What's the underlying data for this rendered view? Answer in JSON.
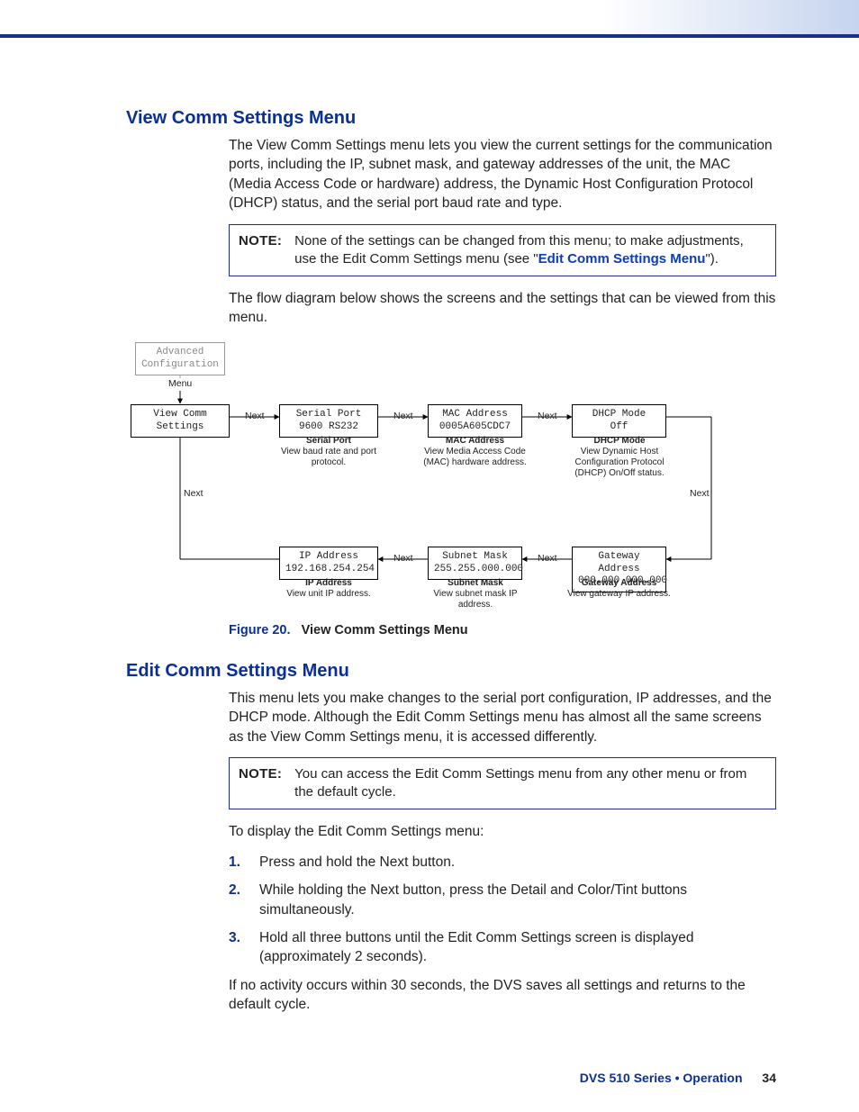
{
  "sections": {
    "view": {
      "heading": "View Comm Settings Menu",
      "intro": "The View Comm Settings menu lets you view the current settings for the communication ports, including the IP, subnet mask, and gateway addresses of the unit, the MAC (Media Access Code or hardware) address, the Dynamic Host Configuration Protocol (DHCP) status, and the serial port baud rate and type.",
      "note_label": "NOTE:",
      "note_text_1": "None of the settings can be changed from this menu; to make adjustments, use the Edit Comm Settings menu (see \"",
      "note_link": "Edit Comm Settings Menu",
      "note_text_2": "\").",
      "flow_intro": "The flow diagram below shows the screens and the settings that can be viewed from this menu."
    },
    "figure": {
      "caption_no": "Figure 20.",
      "caption_title": "View Comm Settings Menu",
      "boxes": {
        "adv_cfg": "Advanced\nConfiguration",
        "menu_label": "Menu",
        "view_comm": "View Comm\nSettings",
        "serial_port": "Serial Port\n9600     RS232",
        "mac": "MAC Address\n0005A605CDC7",
        "dhcp": "DHCP Mode\nOff",
        "ip": "IP Address\n192.168.254.254",
        "subnet": "Subnet Mask\n255.255.000.000",
        "gateway": "Gateway Address\n000.000.000.000"
      },
      "descs": {
        "serial_title": "Serial Port",
        "serial_body": "View baud rate and port protocol.",
        "mac_title": "MAC Address",
        "mac_body": "View Media Access Code (MAC) hardware address.",
        "dhcp_title": "DHCP Mode",
        "dhcp_body": "View Dynamic Host Configuration Protocol (DHCP) On/Off status.",
        "ip_title": "IP Address",
        "ip_body": "View unit IP address.",
        "subnet_title": "Subnet Mask",
        "subnet_body": "View subnet mask IP address.",
        "gateway_title": "Gateway Address",
        "gateway_body": "View gateway IP address."
      },
      "next": "Next"
    },
    "edit": {
      "heading": "Edit Comm Settings Menu",
      "intro": "This menu lets you make changes to the serial port configuration, IP addresses, and the DHCP mode. Although the Edit Comm Settings menu has almost all the same screens as the View Comm Settings menu, it is accessed differently.",
      "note_label": "NOTE:",
      "note_text": "You can access the Edit Comm Settings menu from any other menu or from the default cycle.",
      "to_display": "To display the Edit Comm Settings menu:",
      "steps": [
        "Press and hold the Next button.",
        "While holding the Next button, press the Detail and Color/Tint buttons simultaneously.",
        "Hold all three buttons until the Edit Comm Settings screen is displayed (approximately 2 seconds)."
      ],
      "closing": "If no activity occurs within 30 seconds, the DVS saves all settings and returns to the default cycle."
    }
  },
  "footer": {
    "series": "DVS 510 Series • Operation",
    "page": "34"
  }
}
